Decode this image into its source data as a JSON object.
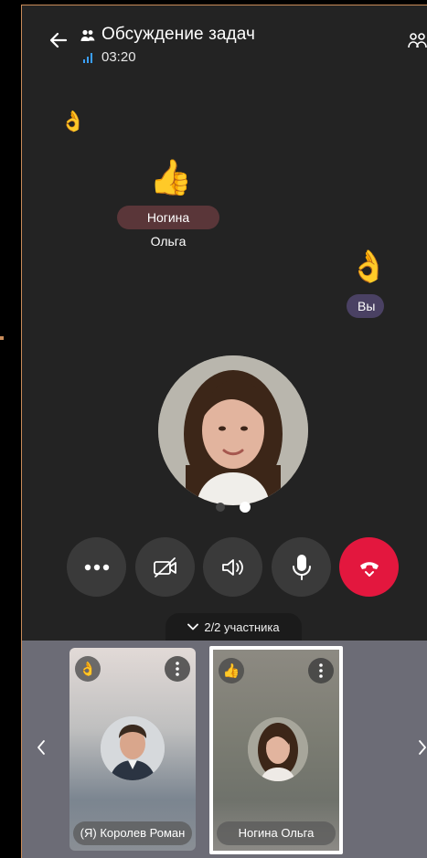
{
  "header": {
    "title": "Обсуждение задач",
    "timer": "03:20"
  },
  "reactions": [
    {
      "emoji": "👌",
      "name": ""
    },
    {
      "emoji": "👍",
      "name": "Ногина Ольга"
    },
    {
      "emoji": "👌",
      "name": "Вы"
    }
  ],
  "pager": {
    "current": 2,
    "total": 2
  },
  "controls": {
    "more": "more-icon",
    "camera": "camera-off-icon",
    "speaker": "speaker-icon",
    "mic": "microphone-icon",
    "end": "end-call-icon"
  },
  "participants_toggle": {
    "label": "2/2 участника"
  },
  "tiles": [
    {
      "reaction": "👌",
      "name": "(Я) Королев Роман"
    },
    {
      "reaction": "👍",
      "name": "Ногина Ольга"
    }
  ],
  "colors": {
    "background": "#232323",
    "end_call": "#e3173e",
    "chip_olga": "#5a3639",
    "chip_you": "#4a4163",
    "strip": "#6c6c76"
  }
}
